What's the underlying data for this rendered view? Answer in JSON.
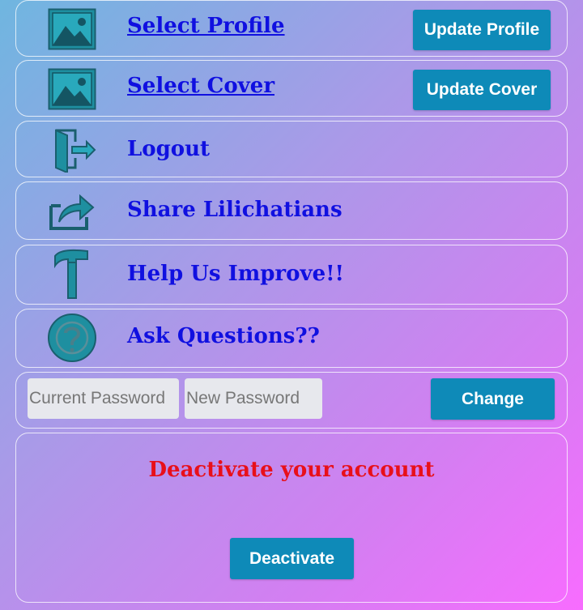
{
  "colors": {
    "accent": "#0e8ab8",
    "link": "#1010e0",
    "danger": "#e8101a",
    "icon": "#1e8fa0"
  },
  "rows": [
    {
      "label": "Select Profile",
      "icon": "image-icon",
      "button": "Update Profile"
    },
    {
      "label": "Select Cover",
      "icon": "image-icon",
      "button": "Update Cover"
    },
    {
      "label": "Logout",
      "icon": "logout-icon"
    },
    {
      "label": "Share Lilichatians",
      "icon": "share-icon"
    },
    {
      "label": "Help Us Improve!!",
      "icon": "hammer-icon"
    },
    {
      "label": "Ask Questions??",
      "icon": "question-icon"
    }
  ],
  "password": {
    "current_placeholder": "Current Password",
    "new_placeholder": "New Password",
    "change_label": "Change"
  },
  "deactivate": {
    "title": "Deactivate your account",
    "button_label": "Deactivate"
  }
}
